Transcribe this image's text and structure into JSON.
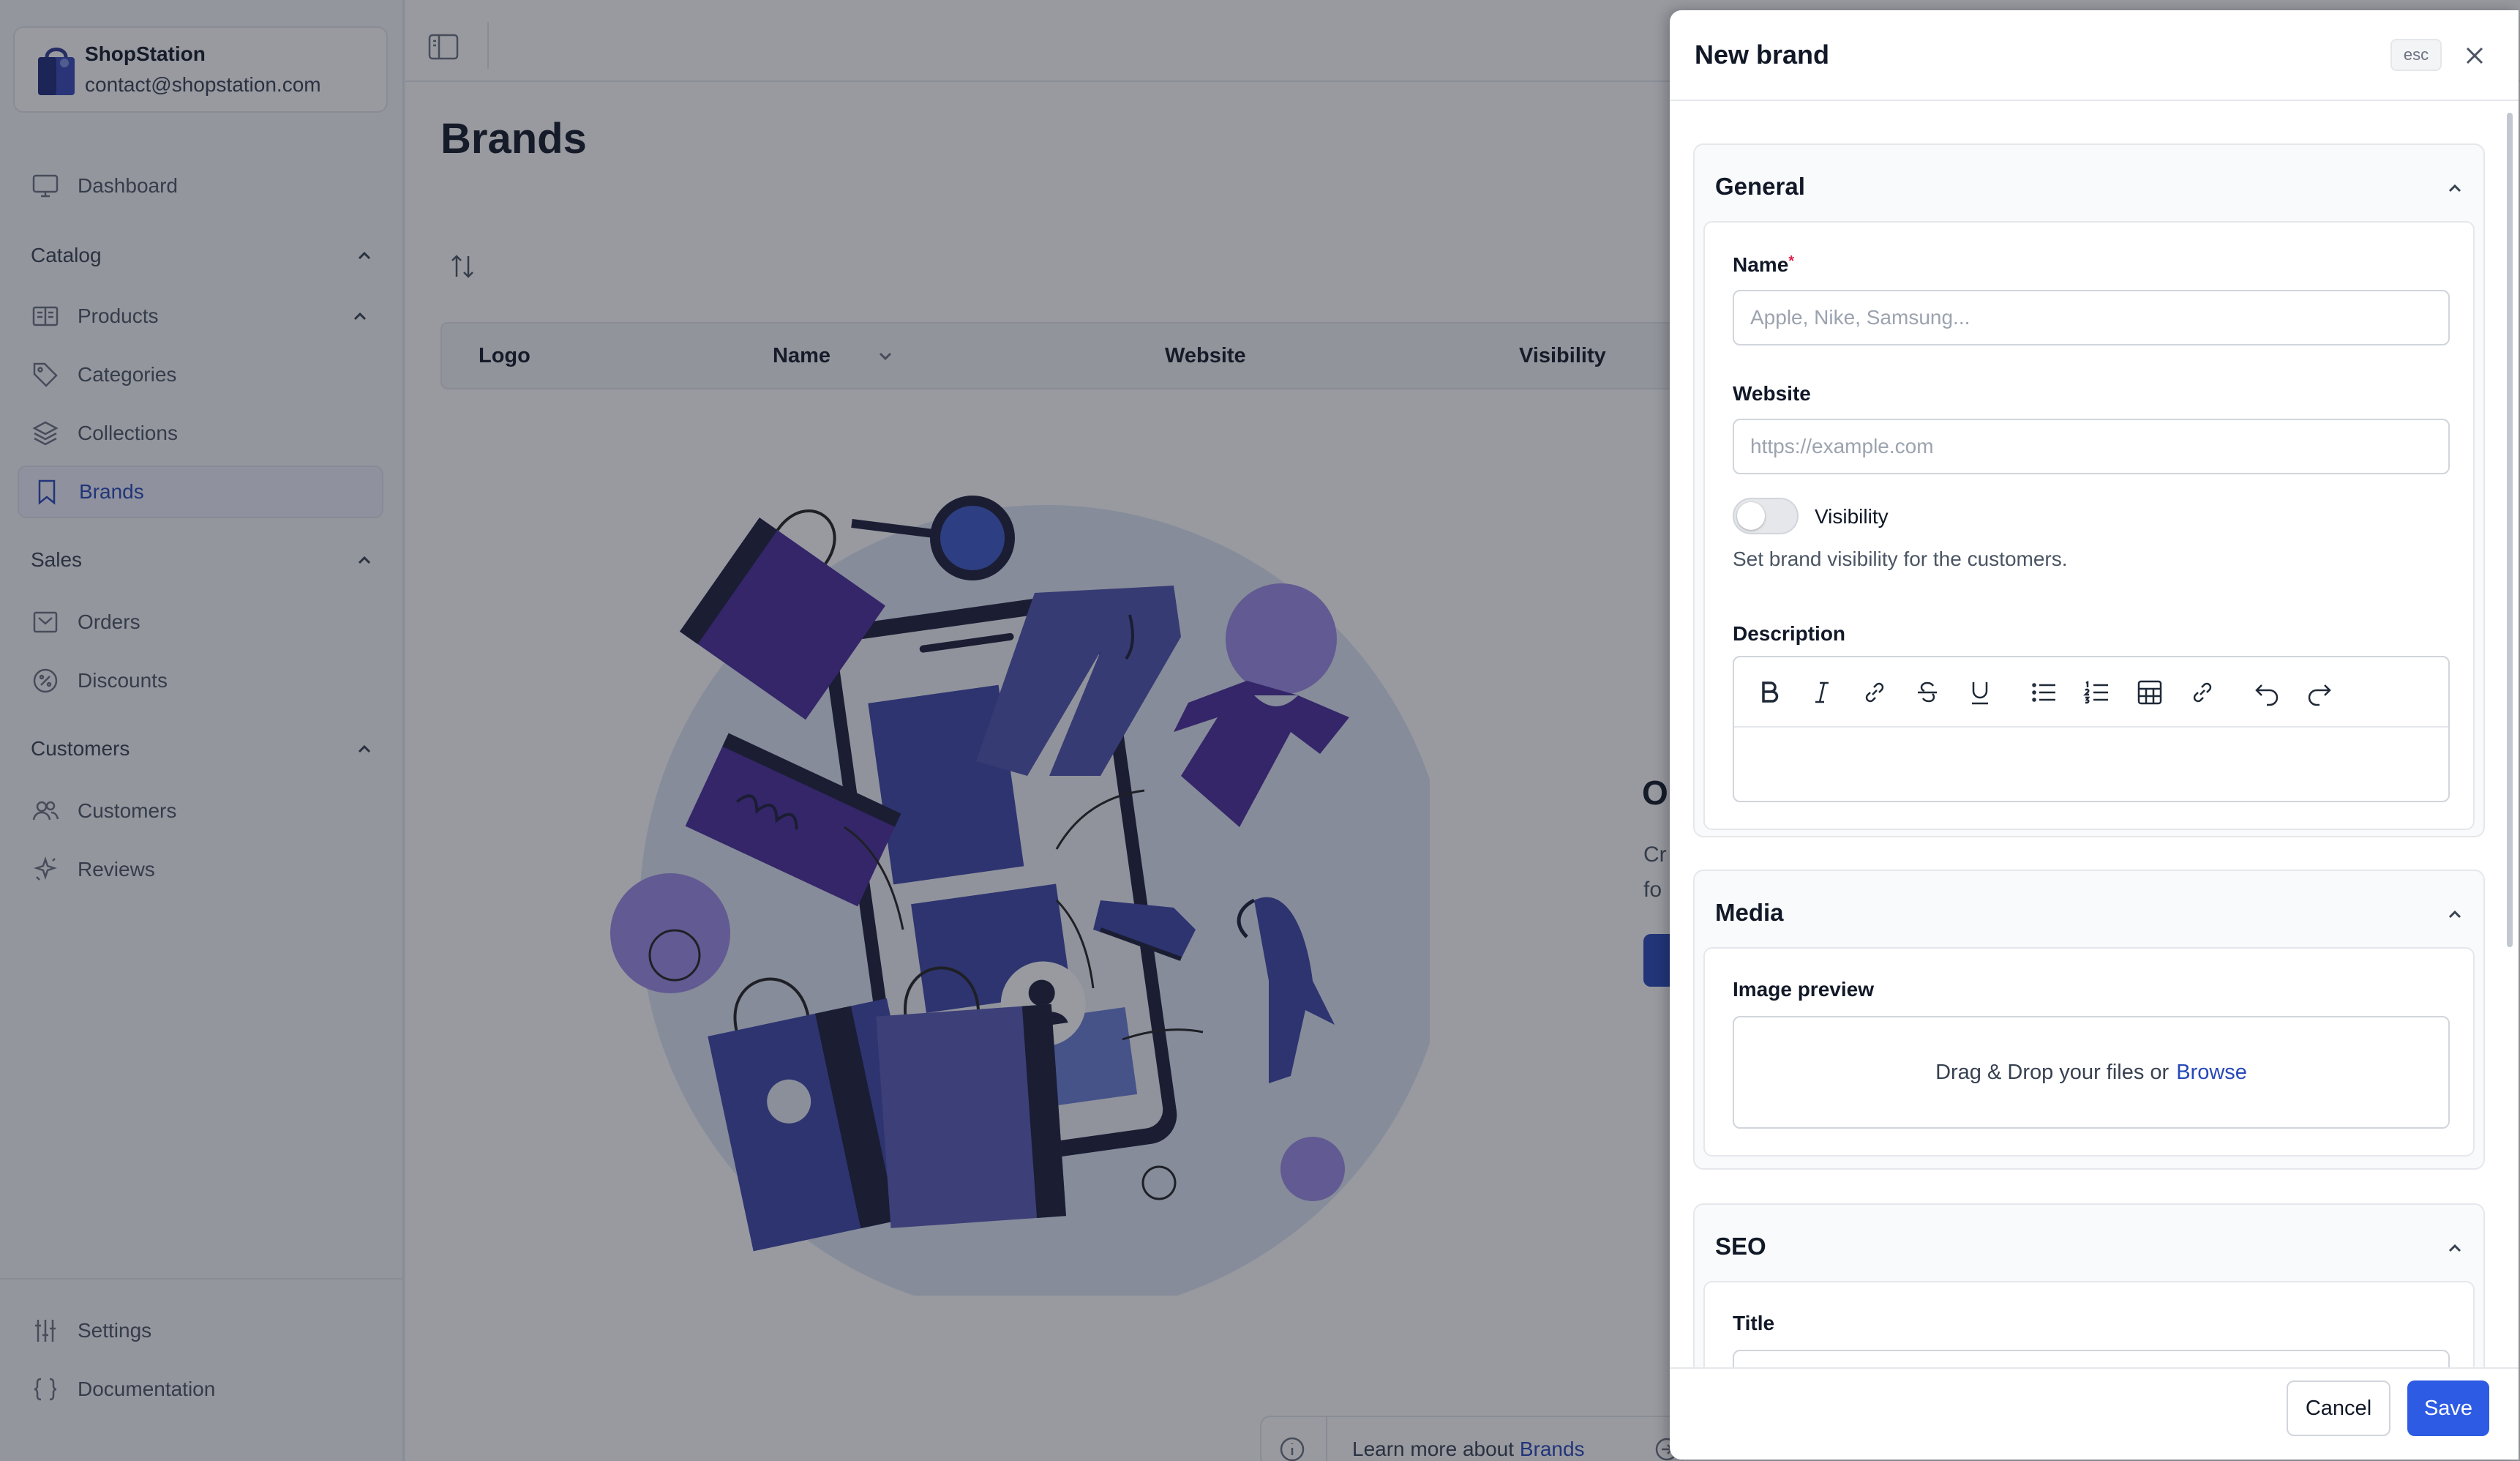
{
  "store": {
    "name": "ShopStation",
    "email": "contact@shopstation.com"
  },
  "sidebar": {
    "dashboard": "Dashboard",
    "catalog": {
      "title": "Catalog",
      "products": "Products",
      "categories": "Categories",
      "collections": "Collections",
      "brands": "Brands"
    },
    "sales": {
      "title": "Sales",
      "orders": "Orders",
      "discounts": "Discounts"
    },
    "customers": {
      "title": "Customers",
      "customers": "Customers",
      "reviews": "Reviews"
    },
    "settings": "Settings",
    "documentation": "Documentation"
  },
  "page": {
    "title": "Brands",
    "columns": {
      "logo": "Logo",
      "name": "Name",
      "website": "Website",
      "visibility": "Visibility"
    },
    "empty": {
      "title": "O",
      "desc": "Cr fo"
    },
    "learn": {
      "prefix": "Learn more about",
      "link": "Brands"
    }
  },
  "drawer": {
    "title": "New brand",
    "esc": "esc",
    "general": {
      "title": "General",
      "name_label": "Name",
      "name_required": "*",
      "name_placeholder": "Apple, Nike, Samsung...",
      "website_label": "Website",
      "website_placeholder": "https://example.com",
      "visibility_label": "Visibility",
      "visibility_on": false,
      "visibility_help": "Set brand visibility for the customers.",
      "description_label": "Description"
    },
    "media": {
      "title": "Media",
      "image_label": "Image preview",
      "drop_text": "Drag & Drop your files or",
      "browse": "Browse"
    },
    "seo": {
      "title": "SEO",
      "title_label": "Title"
    },
    "cancel": "Cancel",
    "save": "Save"
  },
  "colors": {
    "accent": "#2848b8",
    "primary_button": "#2d5be3",
    "illustration_primary": "#3f3a9c"
  }
}
